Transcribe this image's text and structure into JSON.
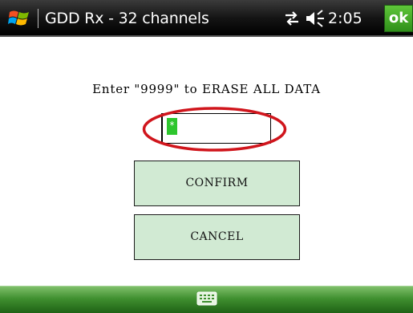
{
  "titlebar": {
    "app_title": "GDD Rx - 32 channels",
    "clock": "2:05",
    "ok_label": "ok",
    "start_icon": "windows-start-icon",
    "connectivity_icon": "connectivity-icon",
    "volume_icon": "volume-icon"
  },
  "dialog": {
    "prompt": "Enter \"9999\" to ERASE ALL DATA",
    "input_value": "",
    "input_cursor_glyph": "*",
    "confirm_label": "CONFIRM",
    "cancel_label": "CANCEL"
  },
  "bottombar": {
    "keyboard_icon": "keyboard-icon"
  },
  "colors": {
    "button_fill": "#d1ead3",
    "highlight_ring": "#d0151c",
    "cursor_fill": "#2ec62e",
    "ok_green": "#3fa325"
  }
}
